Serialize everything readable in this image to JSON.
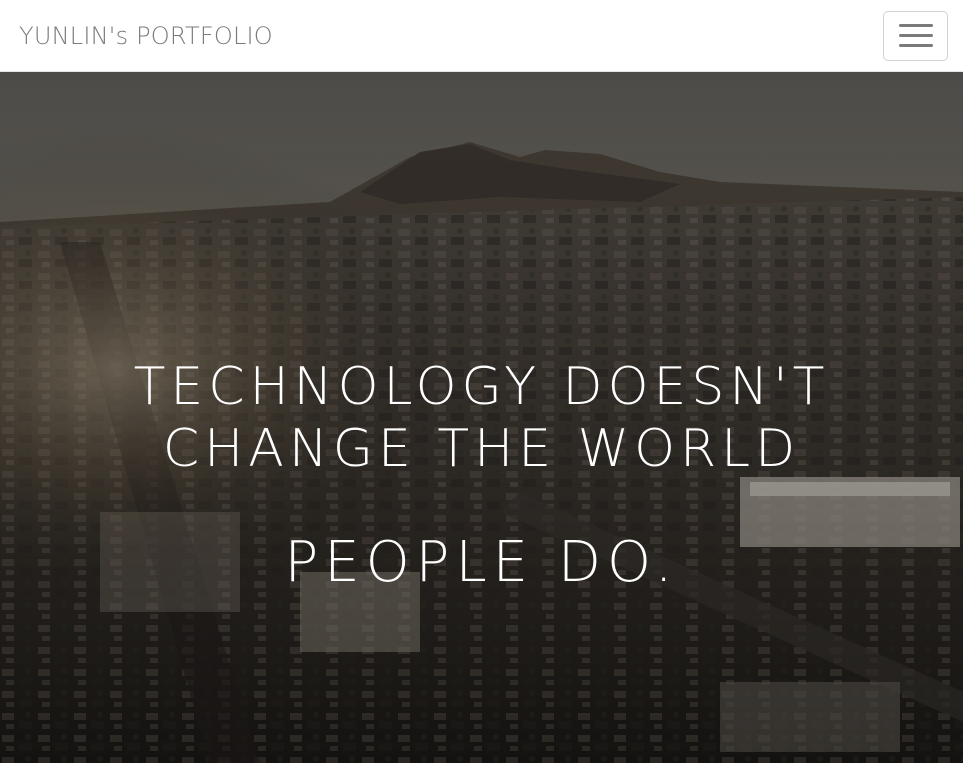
{
  "navbar": {
    "brand": "YUNLIN's PORTFOLIO",
    "menu_icon": "hamburger-menu-icon"
  },
  "hero": {
    "line1": "TECHNOLOGY DOESN'T",
    "line2": "CHANGE THE WORLD",
    "line3": "PEOPLE DO.",
    "background_image": "aerial-town-sunset-photo"
  },
  "colors": {
    "navbar_bg": "#ffffff",
    "brand_text": "#7a7a7a",
    "headline_text": "#ffffff"
  }
}
